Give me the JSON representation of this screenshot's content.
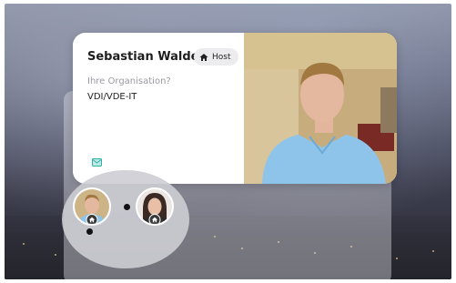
{
  "participant": {
    "name": "Sebastian Walde",
    "role_badge": "Host",
    "organization_label": "Ihre Organisation?",
    "organization_value": "VDI/VDE-IT"
  },
  "icons": {
    "host": "home-icon",
    "message": "message-icon"
  },
  "colors": {
    "card_bg": "#ffffff",
    "badge_bg": "#ececef",
    "accent": "#2bb3a6",
    "muted_text": "#9a9aa0"
  }
}
